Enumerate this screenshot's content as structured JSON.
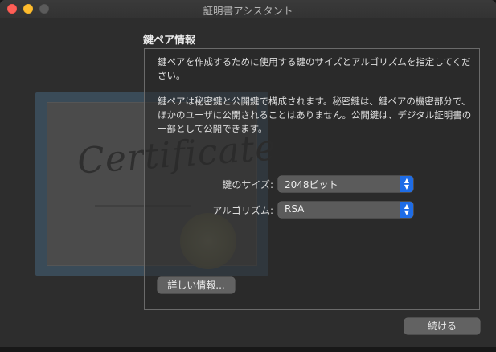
{
  "window": {
    "title": "証明書アシスタント"
  },
  "section": {
    "title": "鍵ペア情報"
  },
  "panel": {
    "paragraph1": "鍵ペアを作成するために使用する鍵のサイズとアルゴリズムを指定してください。",
    "paragraph2": "鍵ペアは秘密鍵と公開鍵で構成されます。秘密鍵は、鍵ペアの機密部分で、ほかのユーザに公開されることはありません。公開鍵は、デジタル証明書の一部として公開できます。",
    "key_size": {
      "label": "鍵のサイズ:",
      "selected": "2048ビット"
    },
    "algorithm": {
      "label": "アルゴリズム:",
      "selected": "RSA"
    },
    "details_button": "詳しい情報..."
  },
  "footer": {
    "continue_button": "続ける"
  },
  "illustration": {
    "text": "Certificate"
  },
  "colors": {
    "accent": "#1e6ce6",
    "close": "#fe5f57",
    "minimize": "#febc2e",
    "zoom": "#5b5b5b"
  }
}
